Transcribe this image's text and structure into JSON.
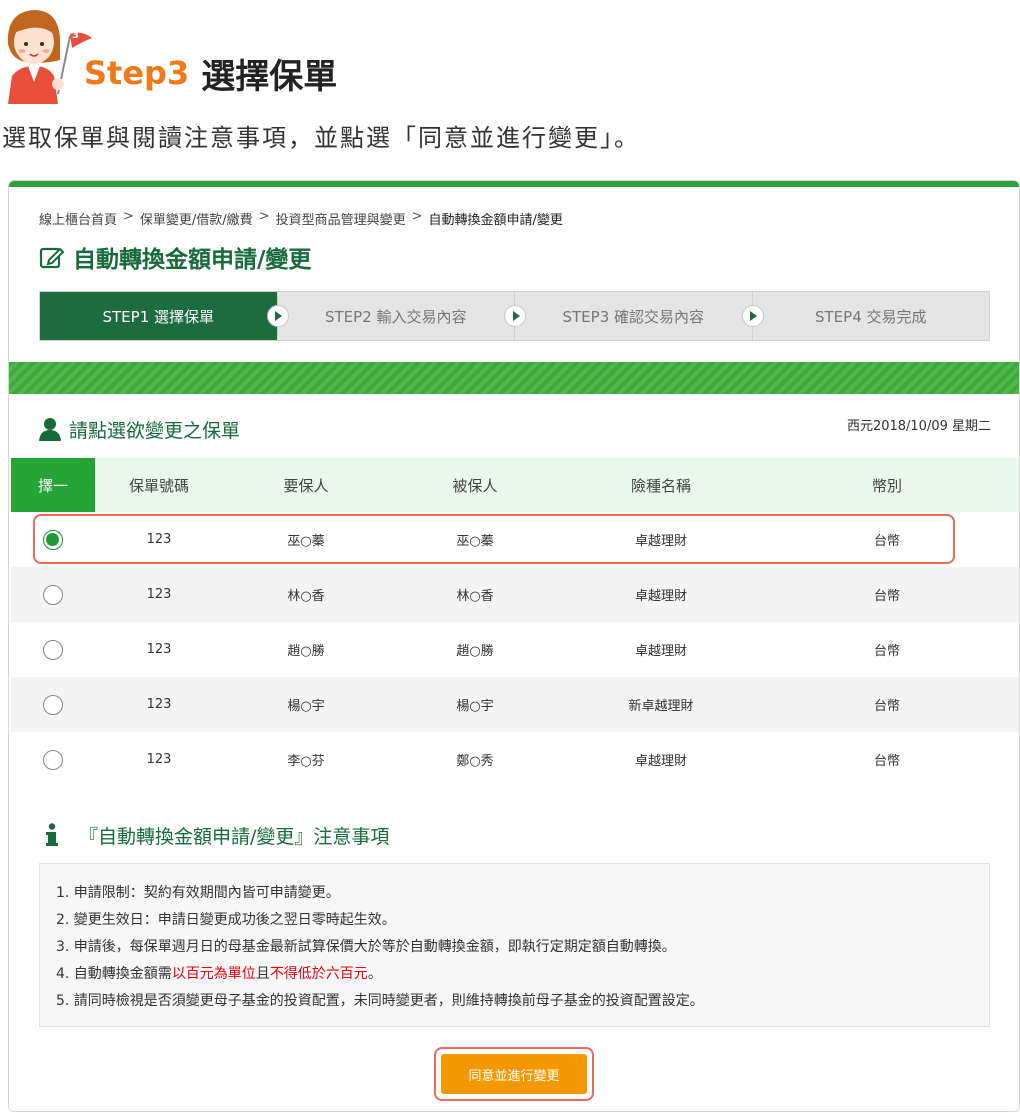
{
  "header": {
    "step_number": "Step3",
    "step_text": "選擇保單",
    "intro": "選取保單與閱讀注意事項，並點選「同意並進行變更」。",
    "flag_number": "3"
  },
  "breadcrumb": {
    "items": [
      "線上櫃台首頁",
      "保單變更/借款/繳費",
      "投資型商品管理與變更",
      "自動轉換金額申請/變更"
    ],
    "separator": ">"
  },
  "page_title": "自動轉換金額申請/變更",
  "steps": [
    {
      "label": "STEP1 選擇保單",
      "active": true
    },
    {
      "label": "STEP2 輸入交易內容",
      "active": false
    },
    {
      "label": "STEP3 確認交易內容",
      "active": false
    },
    {
      "label": "STEP4 交易完成",
      "active": false
    }
  ],
  "section": {
    "title": "請點選欲變更之保單",
    "date": "西元2018/10/09 星期二"
  },
  "table": {
    "headers": [
      "擇一",
      "保單號碼",
      "要保人",
      "被保人",
      "險種名稱",
      "幣別"
    ],
    "rows": [
      {
        "checked": true,
        "policy": "123",
        "holder": "巫○蓁",
        "insured": "巫○蓁",
        "product": "卓越理財",
        "currency": "台幣"
      },
      {
        "checked": false,
        "policy": "123",
        "holder": "林○香",
        "insured": "林○香",
        "product": "卓越理財",
        "currency": "台幣"
      },
      {
        "checked": false,
        "policy": "123",
        "holder": "趙○勝",
        "insured": "趙○勝",
        "product": "卓越理財",
        "currency": "台幣"
      },
      {
        "checked": false,
        "policy": "123",
        "holder": "楊○宇",
        "insured": "楊○宇",
        "product": "新卓越理財",
        "currency": "台幣"
      },
      {
        "checked": false,
        "policy": "123",
        "holder": "李○芬",
        "insured": "鄭○秀",
        "product": "卓越理財",
        "currency": "台幣"
      }
    ]
  },
  "notes": {
    "title": "『自動轉換金額申請/變更』注意事項",
    "item1": "1. 申請限制：契約有效期間內皆可申請變更。",
    "item2": "2. 變更生效日：申請日變更成功後之翌日零時起生效。",
    "item3": "3. 申請後，每保單週月日的母基金最新試算保價大於等於自動轉換金額，即執行定期定額自動轉換。",
    "item4_a": "4. 自動轉換金額需",
    "item4_red1": "以百元為單位",
    "item4_b": "且",
    "item4_red2": "不得低於六百元",
    "item4_c": "。",
    "item5": "5. 請同時檢視是否須變更母子基金的投資配置，未同時變更者，則維持轉換前母子基金的投資配置設定。"
  },
  "confirm_button": "同意並進行變更",
  "colors": {
    "brand_green": "#1d6b3f",
    "accent_green": "#25a535",
    "orange": "#f39800",
    "highlight_red": "#ec6b5c",
    "alert_red": "#e60012"
  }
}
